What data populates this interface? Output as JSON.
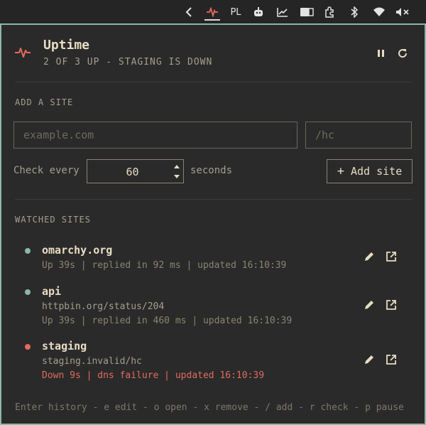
{
  "topbar": {
    "keyboard_layout": "PL"
  },
  "header": {
    "title": "Uptime",
    "subtitle": "2 OF 3 UP - STAGING IS DOWN"
  },
  "add_site": {
    "section_label": "ADD A SITE",
    "url_placeholder": "example.com",
    "path_placeholder": "/hc",
    "check_every_label": "Check every",
    "interval_value": "60",
    "seconds_label": "seconds",
    "add_button_label": "Add site",
    "add_button_icon": "+"
  },
  "watched": {
    "section_label": "WATCHED SITES",
    "sites": [
      {
        "name": "omarchy.org",
        "url": "",
        "status": "Up 39s | replied in 92 ms | updated 16:10:39",
        "state": "up",
        "dot_color": "#8ab8a8"
      },
      {
        "name": "api",
        "url": "httpbin.org/status/204",
        "status": "Up 39s | replied in 460 ms | updated 16:10:39",
        "state": "up",
        "dot_color": "#8ab8a8"
      },
      {
        "name": "staging",
        "url": "staging.invalid/hc",
        "status": "Down 9s | dns failure | updated 16:10:39",
        "state": "down",
        "dot_color": "#e06c5e"
      }
    ]
  },
  "footer": {
    "hint": "Enter history - e edit - o open - x remove - / add - r check - p pause"
  },
  "colors": {
    "accent_border": "#8ab8a8",
    "up": "#8ab8a8",
    "down": "#e06c5e",
    "pulse_icon": "#e06c5e"
  }
}
